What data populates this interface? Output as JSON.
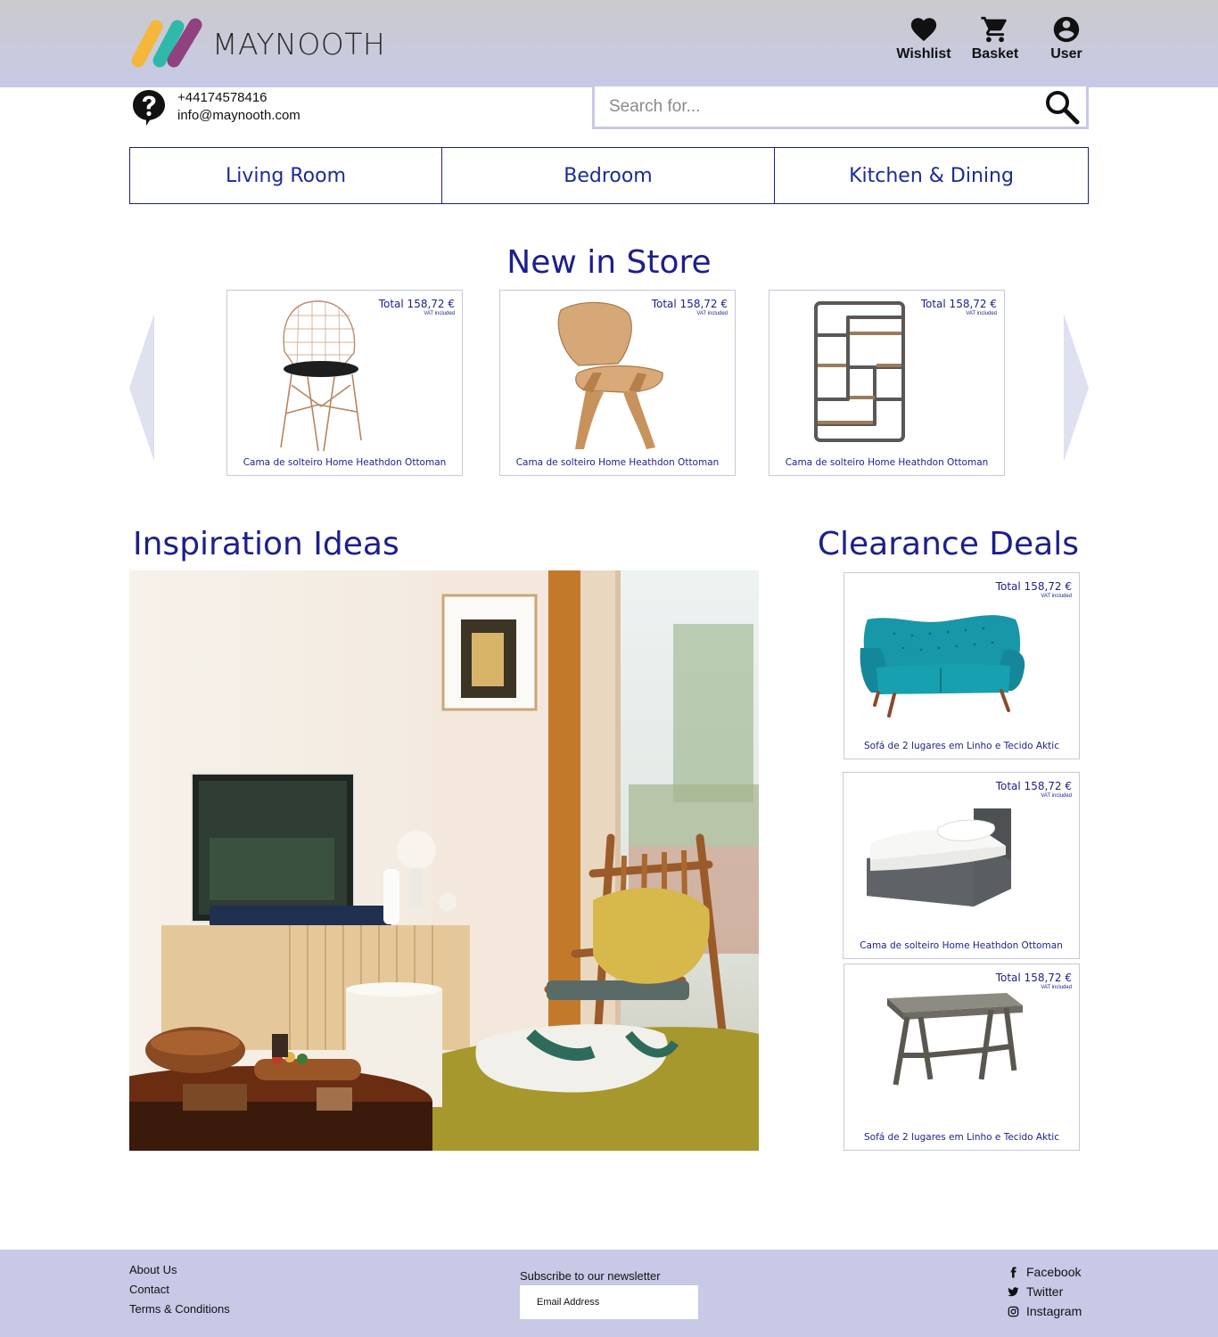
{
  "brand": {
    "name": "MAYNOOTH"
  },
  "header": {
    "actions": [
      {
        "label": "Wishlist",
        "icon": "heart-icon"
      },
      {
        "label": "Basket",
        "icon": "cart-icon"
      },
      {
        "label": "User",
        "icon": "account-circle-icon"
      }
    ]
  },
  "contact": {
    "phone": "+44174578416",
    "email": "info@maynooth.com",
    "icon": "help-bubble-icon"
  },
  "search": {
    "placeholder": "Search for...",
    "icon": "search-icon"
  },
  "categories": [
    "Living Room",
    "Bedroom",
    "Kitchen & Dining"
  ],
  "new_in_store": {
    "title": "New in Store",
    "items": [
      {
        "price": "Total 158,72 €",
        "vat": "VAT included",
        "name": "Cama de solteiro Home Heathdon Ottoman",
        "image": "wire-chair"
      },
      {
        "price": "Total 158,72 €",
        "vat": "VAT included",
        "name": "Cama de solteiro Home Heathdon Ottoman",
        "image": "plywood-lounge-chair"
      },
      {
        "price": "Total 158,72 €",
        "vat": "VAT included",
        "name": "Cama de solteiro Home Heathdon Ottoman",
        "image": "metal-wall-shelf"
      }
    ]
  },
  "inspiration": {
    "title": "Inspiration Ideas",
    "image": "living-room-photo"
  },
  "clearance": {
    "title": "Clearance Deals",
    "items": [
      {
        "price": "Total 158,72 €",
        "vat": "VAT included",
        "name": "Sofá de 2 lugares em Linho e Tecido Aktic",
        "image": "teal-sofa"
      },
      {
        "price": "Total 158,72 €",
        "vat": "VAT included",
        "name": "Cama de solteiro Home Heathdon Ottoman",
        "image": "grey-single-bed"
      },
      {
        "price": "Total 158,72 €",
        "vat": "VAT included",
        "name": "Sofá de 2 lugares em Linho e Tecido Aktic",
        "image": "grey-dining-table"
      }
    ]
  },
  "footer": {
    "links": [
      "About Us",
      "Contact",
      "Terms & Conditions"
    ],
    "newsletter": {
      "label": "Subscribe to our newsletter",
      "placeholder": "Email Address"
    },
    "social": [
      {
        "label": "Facebook",
        "icon": "facebook-icon"
      },
      {
        "label": "Twitter",
        "icon": "twitter-icon"
      },
      {
        "label": "Instagram",
        "icon": "instagram-icon"
      }
    ]
  },
  "colors": {
    "header_bg": "#c7c9e6",
    "accent": "#1c1f8c",
    "footer_bg": "#c7c9e6"
  }
}
